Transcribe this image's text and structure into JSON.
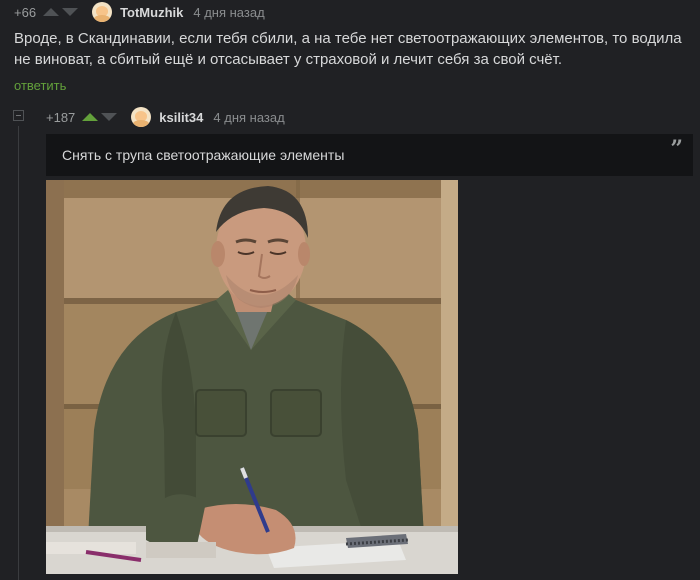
{
  "comment_parent": {
    "rating": "+66",
    "author": "TotMuzhik",
    "time": "4 дня назад",
    "text": "Вроде, в Скандинавии, если тебя сбили, а на тебе нет светоотражающих элементов, то водила не виноват, а сбитый ещё и отсасывает у страховой и лечит себя за свой счёт.",
    "reply_label": "ответить"
  },
  "comment_reply": {
    "rating": "+187",
    "author": "ksilit34",
    "time": "4 дня назад",
    "quote": "Снять с трупа светоотражающие элементы",
    "quote_icon": "quote-icon"
  },
  "colors": {
    "background": "#202124",
    "accent_green": "#63a13b",
    "quote_background": "#131416",
    "text": "#d7d8d9",
    "muted": "#8a8d8f"
  }
}
